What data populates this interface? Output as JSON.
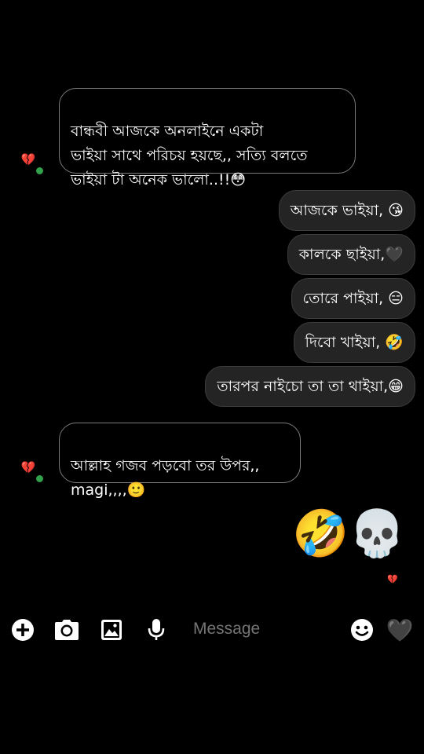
{
  "thread": {
    "received": [
      {
        "text": "বান্ধবী আজকে অনলাইনে একটা\nভাইয়া সাথে পরিচয় হয়ছে,, সত্যি বলতে\nভাইয়া টা অনেক ভালো..!!😳"
      },
      {
        "text": "আল্লাহ গজব পড়বো তর উপর,,\nmagi,,,,🙂"
      }
    ],
    "sent": [
      {
        "text": "আজকে ভাইয়া, 😘"
      },
      {
        "text": "কালকে ছাইয়া,🖤"
      },
      {
        "text": "তোরে পাইয়া, 😑"
      },
      {
        "text": "দিবো খাইয়া, 🤣"
      },
      {
        "text": "তারপর নাইচো তা তা থাইয়া,😁"
      }
    ],
    "big_emojis": [
      "🤣",
      "💀"
    ],
    "avatar_glyph": "💔",
    "seen_glyph": "💔"
  },
  "composer": {
    "placeholder": "Message",
    "like_emoji": "🖤"
  },
  "colors": {
    "background": "#000000",
    "sent_bubble": "#242424",
    "received_border": "#7a7a7a",
    "online": "#31a24c",
    "icon": "#ffffff"
  }
}
